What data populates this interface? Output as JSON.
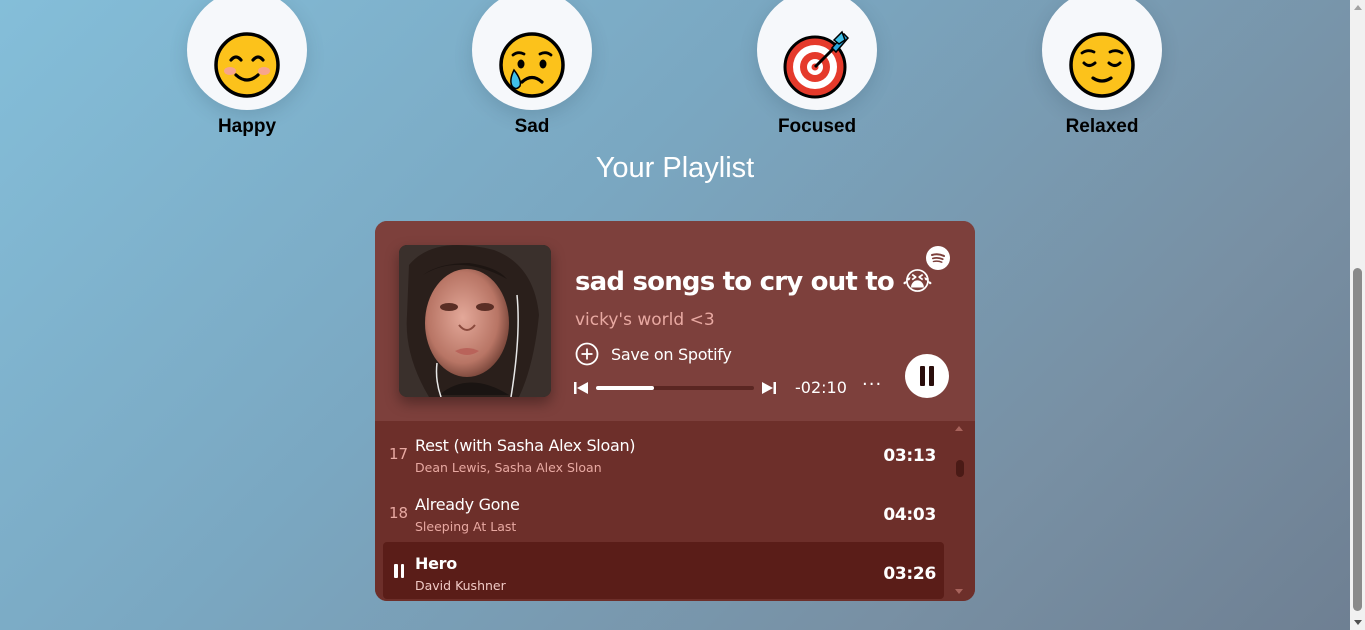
{
  "moods": [
    {
      "label": "Happy",
      "icon": "smiling-face-icon"
    },
    {
      "label": "Sad",
      "icon": "crying-face-icon"
    },
    {
      "label": "Focused",
      "icon": "target-icon"
    },
    {
      "label": "Relaxed",
      "icon": "relieved-face-icon"
    }
  ],
  "playlist_heading": "Your Playlist",
  "player": {
    "title": "sad songs to cry out to 😭",
    "owner": "vicky's world <3",
    "save_label": "Save on Spotify",
    "time_remaining": "-02:10",
    "progress": 0.37,
    "more_label": "···",
    "colors": {
      "card_bg": "#7d403c",
      "list_bg": "#6d2f2a",
      "accent_text": "#e8a9a2"
    }
  },
  "tracks": [
    {
      "number": "17",
      "title": "Rest (with Sasha Alex Sloan)",
      "artist": "Dean Lewis, Sasha Alex Sloan",
      "duration": "03:13",
      "playing": false
    },
    {
      "number": "18",
      "title": "Already Gone",
      "artist": "Sleeping At Last",
      "duration": "04:03",
      "playing": false
    },
    {
      "number": "",
      "title": "Hero",
      "artist": "David Kushner",
      "duration": "03:26",
      "playing": true
    }
  ]
}
